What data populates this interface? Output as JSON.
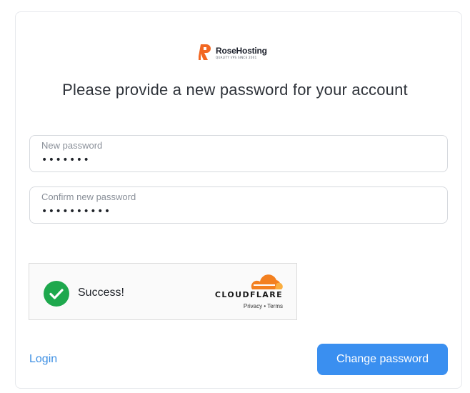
{
  "brand": {
    "name": "RoseHosting",
    "tagline": "QUALITY VPS SINCE 2001",
    "accent_color": "#f26722"
  },
  "heading": "Please provide a new password for your account",
  "fields": [
    {
      "label": "New password",
      "value": "•••••••"
    },
    {
      "label": "Confirm new password",
      "value": "••••••••••"
    }
  ],
  "captcha": {
    "status": "Success!",
    "provider": "CLOUDFLARE",
    "privacy_label": "Privacy",
    "separator": "•",
    "terms_label": "Terms",
    "status_color": "#1ea84d",
    "cloud_color": "#f38020"
  },
  "login_link": "Login",
  "submit_label": "Change password",
  "submit_color": "#3a8ff0"
}
